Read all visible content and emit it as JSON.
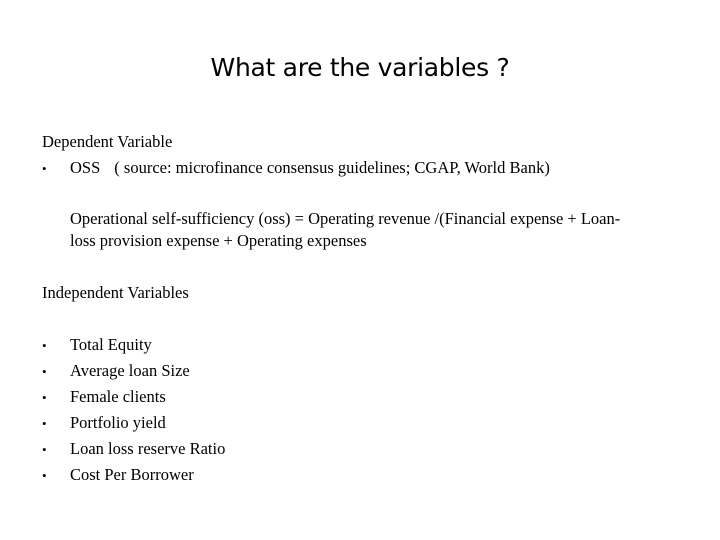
{
  "slide": {
    "title": "What are the variables ?",
    "dependent": {
      "heading": "Dependent Variable",
      "bullet": "•",
      "item_name": "OSS",
      "item_source": "( source: microfinance consensus guidelines; CGAP, World Bank)",
      "definition_line1": "Operational self-sufficiency (oss) = Operating revenue /(Financial expense + Loan-",
      "definition_line2": "loss provision expense + Operating expenses"
    },
    "independent": {
      "heading": "Independent Variables",
      "bullet": "•",
      "items": [
        "Total Equity",
        "Average loan Size",
        "Female clients",
        "Portfolio yield",
        "Loan loss reserve Ratio",
        "Cost Per Borrower"
      ]
    }
  }
}
